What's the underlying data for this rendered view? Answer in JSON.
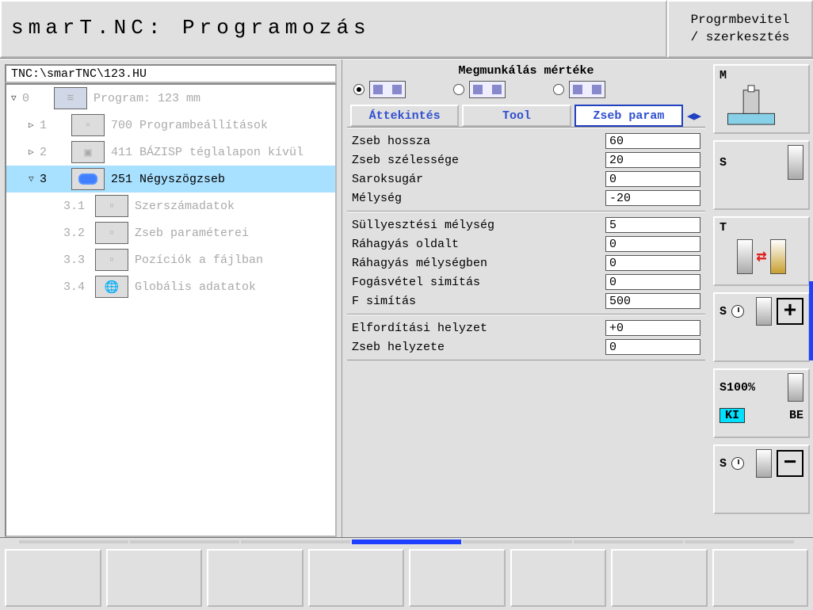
{
  "header": {
    "title": "smarT.NC: Programozás",
    "mode_line1": "Progrmbevitel",
    "mode_line2": "/ szerkesztés"
  },
  "path": "TNC:\\smarTNC\\123.HU",
  "tree": [
    {
      "exp": "▽",
      "idx": "0",
      "icon": "prog",
      "label": "Program: 123 mm",
      "indent": 0
    },
    {
      "exp": "▷",
      "idx": "1",
      "icon": "set",
      "label": "700 Programbeállítások",
      "indent": 1
    },
    {
      "exp": "▷",
      "idx": "2",
      "icon": "datum",
      "label": "411 BÁZISP téglalapon kívül",
      "indent": 1
    },
    {
      "exp": "▽",
      "idx": "3",
      "icon": "rect",
      "label": "251 Négyszögzseb",
      "indent": 1,
      "selected": true
    },
    {
      "exp": "",
      "idx": "3.1",
      "icon": "tool",
      "label": "Szerszámadatok",
      "indent": 2
    },
    {
      "exp": "",
      "idx": "3.2",
      "icon": "param",
      "label": "Zseb paraméterei",
      "indent": 2
    },
    {
      "exp": "",
      "idx": "3.3",
      "icon": "pos",
      "label": "Pozíciók a fájlban",
      "indent": 2
    },
    {
      "exp": "",
      "idx": "3.4",
      "icon": "globe",
      "label": "Globális adatatok",
      "indent": 2
    }
  ],
  "section_title": "Megmunkálás mértéke",
  "radio_selected": 0,
  "tabs": {
    "items": [
      "Áttekintés",
      "Tool",
      "Zseb param"
    ],
    "active": 2
  },
  "params": [
    [
      {
        "label": "Zseb hossza",
        "value": "60"
      },
      {
        "label": "Zseb szélessége",
        "value": "20"
      },
      {
        "label": "Saroksugár",
        "value": "0"
      },
      {
        "label": "Mélység",
        "value": "-20"
      }
    ],
    [
      {
        "label": "Süllyesztési mélység",
        "value": "5"
      },
      {
        "label": "Ráhagyás oldalt",
        "value": "0"
      },
      {
        "label": "Ráhagyás mélységben",
        "value": "0"
      },
      {
        "label": "Fogásvétel simítás",
        "value": "0"
      },
      {
        "label": "F simítás",
        "value": "500"
      }
    ],
    [
      {
        "label": "Elfordítási helyzet",
        "value": "+0"
      },
      {
        "label": "Zseb helyzete",
        "value": "0"
      }
    ]
  ],
  "right_softkeys": {
    "m": "M",
    "s": "S",
    "t": "T",
    "s_plus": "S",
    "s100_label": "S100%",
    "ki": "KI",
    "be": "BE",
    "s_minus": "S"
  },
  "bottom_pages_active": 3,
  "bottom_key_count": 8
}
